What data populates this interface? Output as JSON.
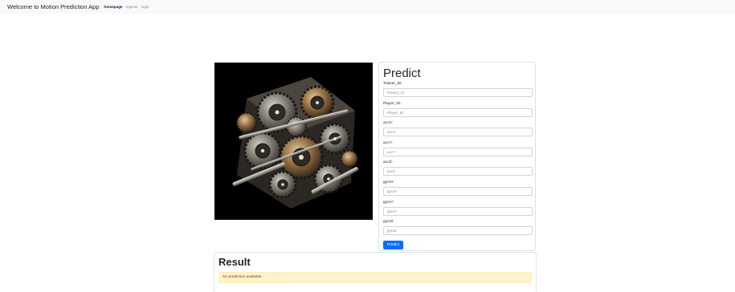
{
  "navbar": {
    "brand": "Welcome to Motion Prediction App",
    "links": [
      {
        "label": "homepage",
        "active": true
      },
      {
        "label": "register",
        "active": false
      },
      {
        "label": "login",
        "active": false
      }
    ]
  },
  "image": {
    "subject": "mechanical-gear-engine"
  },
  "predict_form": {
    "title": "Predict",
    "fields": [
      {
        "label": "Trainer_ID:",
        "placeholder": "Trainer_ID",
        "value": ""
      },
      {
        "label": "Player_ID:",
        "placeholder": "Player_ID",
        "value": ""
      },
      {
        "label": "accX:",
        "placeholder": "accX",
        "value": ""
      },
      {
        "label": "accY:",
        "placeholder": "accY",
        "value": ""
      },
      {
        "label": "accZ:",
        "placeholder": "accZ",
        "value": ""
      },
      {
        "label": "gyroX:",
        "placeholder": "gyroX",
        "value": ""
      },
      {
        "label": "gyroY:",
        "placeholder": "gyroY",
        "value": ""
      },
      {
        "label": "gyroZ:",
        "placeholder": "gyroZ",
        "value": ""
      }
    ],
    "submit_label": "Predict"
  },
  "result": {
    "title": "Result",
    "message": "No prediction available."
  },
  "colors": {
    "primary": "#0d6efd",
    "navbar_bg": "#f8f9fa",
    "alert_bg": "#fff3cd",
    "alert_text": "#664d03"
  }
}
